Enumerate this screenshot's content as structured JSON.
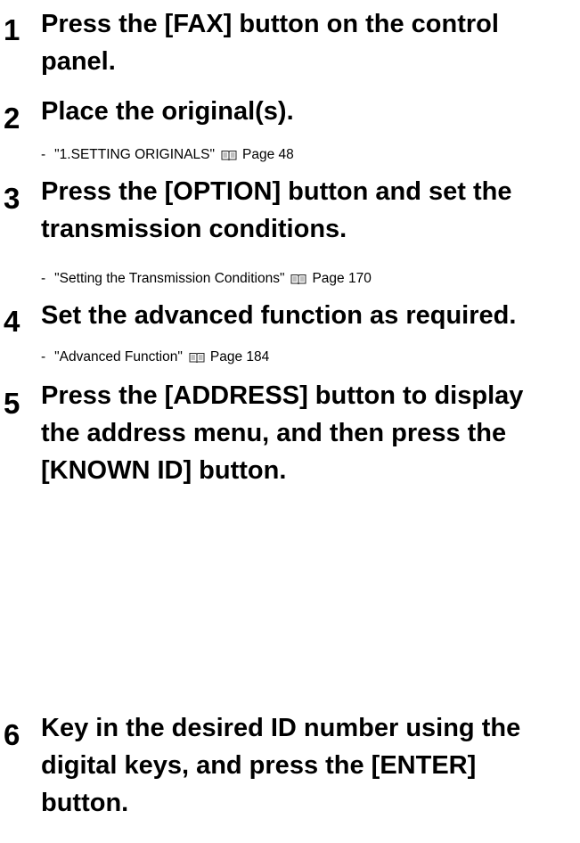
{
  "steps": [
    {
      "number": "1",
      "lines": [
        "Press the [FAX] button on the control",
        "panel."
      ]
    },
    {
      "number": "2",
      "lines": [
        "Place the original(s)."
      ],
      "reference": {
        "dash": "-",
        "link": "\"1.SETTING ORIGINALS\"",
        "page": "Page 48"
      }
    },
    {
      "number": "3",
      "lines": [
        "Press the [OPTION] button and set the",
        "transmission conditions."
      ],
      "reference": {
        "dash": "-",
        "link": "\"Setting the Transmission Conditions\"",
        "page": "Page 170"
      }
    },
    {
      "number": "4",
      "lines": [
        "Set the advanced function as required."
      ],
      "reference": {
        "dash": "-",
        "link": "\"Advanced Function\"",
        "page": "Page 184"
      }
    },
    {
      "number": "5",
      "lines": [
        "Press the [ADDRESS] button to display",
        "the address menu, and then press the",
        "[KNOWN ID] button."
      ]
    },
    {
      "number": "6",
      "lines": [
        "Key in the desired ID number using the",
        "digital keys, and press the [ENTER]",
        "button."
      ]
    }
  ],
  "icons": {
    "reference_icon": "book-icon"
  }
}
